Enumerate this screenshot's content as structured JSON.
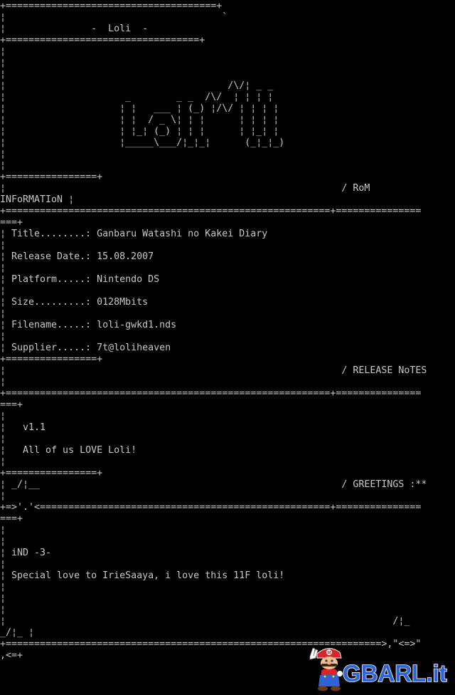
{
  "colors": {
    "background": "#000000",
    "text": "#c8c8c8",
    "watermark_fill": "#2f63d6",
    "watermark_outline": "#ffffff"
  },
  "nfo": {
    "lines": [
      "+=====================================+",
      "¦                                      `",
      "¦               -  Loli  -",
      "+==================================+",
      "¦",
      "¦",
      "¦",
      "¦                                       /\\/¦ _ _",
      "¦                     _        _ _  /\\/  ¦ ¦ ¦ ¦",
      "¦                    ¦ ¦   ___ ¦ (_) ¦/\\/ ¦ ¦ ¦ ¦",
      "¦                    ¦ ¦  / _ \\¦ ¦ ¦      ¦ ¦ ¦ ¦",
      "¦                    ¦ ¦_¦ (_) ¦ ¦ ¦      ¦ ¦_¦ ¦",
      "¦                    ¦_____\\___/¦_¦_¦      (_¦_¦_)",
      "¦",
      "¦",
      "+================+",
      "¦                                                           / RoM",
      "INFoRMATIoN ¦",
      "+=========================================================+===============",
      "===+",
      "¦ Title........: Ganbaru Watashi no Kakei Diary",
      "¦",
      "¦ Release Date.: 15.08.2007",
      "¦",
      "¦ Platform.....: Nintendo DS",
      "¦",
      "¦ Size.........: 0128Mbits",
      "¦",
      "¦ Filename.....: loli-gwkd1.nds",
      "¦",
      "¦ Supplier.....: 7t@loliheaven",
      "+================+",
      "¦                                                           / RELEASE NoTES",
      "¦",
      "+=========================================================+===============",
      "===+",
      "¦",
      "¦   v1.1",
      "¦",
      "¦   All of us LOVE Loli!",
      "¦",
      "+================+",
      "¦ _/¦__                                                     / GREETINGS :**",
      "¦",
      "+=>'.'<===================================================+===============",
      "===+",
      "¦",
      "¦",
      "¦ iND -3-",
      "¦",
      "¦ Special love to IrieSaaya, i love this 11F loli!",
      "¦",
      "¦",
      "¦",
      "¦                                                                    /¦_",
      "_/¦_ ¦",
      "+==================================================================>,\"<=>\"",
      ",<=+"
    ]
  },
  "watermark": {
    "text": "GBARL.it",
    "mascot_icon": "mario-peace-sign-icon"
  }
}
